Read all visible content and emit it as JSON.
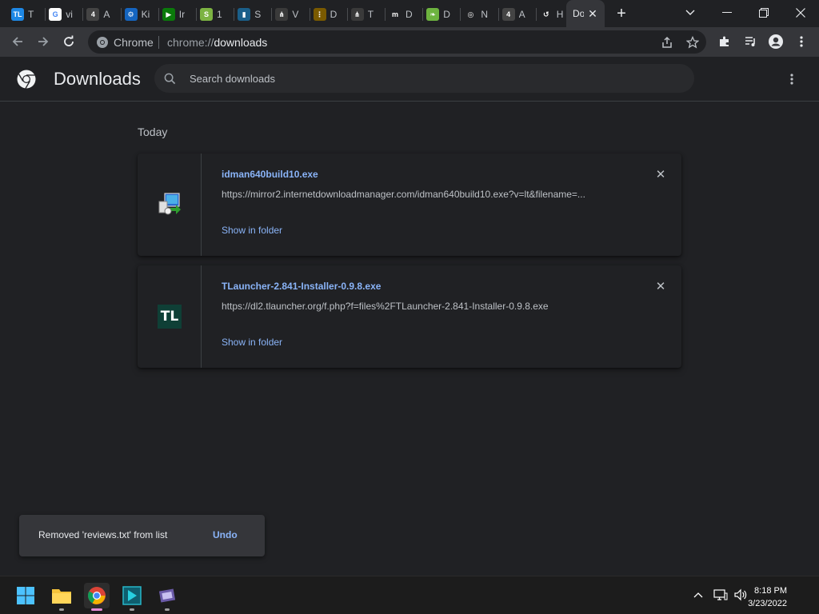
{
  "tabs": [
    {
      "fav": "TL",
      "title": "T",
      "bg": "#1e88e5"
    },
    {
      "fav": "G",
      "title": "vi",
      "bg": "#ffffff"
    },
    {
      "fav": "4",
      "title": "A",
      "bg": "#444444"
    },
    {
      "fav": "⚙",
      "title": "Ki",
      "bg": "#1565c0"
    },
    {
      "fav": "▶",
      "title": "Ir",
      "bg": "#0a7a0a"
    },
    {
      "fav": "S",
      "title": "1",
      "bg": "#7cb342"
    },
    {
      "fav": "▮",
      "title": "S",
      "bg": "#1a5f8a"
    },
    {
      "fav": "⋔",
      "title": "V",
      "bg": "#3a3a3a"
    },
    {
      "fav": "⋮",
      "title": "D",
      "bg": "#7a5a00"
    },
    {
      "fav": "⋔",
      "title": "T",
      "bg": "#3a3a3a"
    },
    {
      "fav": "m",
      "title": "D",
      "bg": "#202124"
    },
    {
      "fav": "❧",
      "title": "D",
      "bg": "#6db33f"
    },
    {
      "fav": "◎",
      "title": "N",
      "bg": "#202124"
    },
    {
      "fav": "4",
      "title": "A",
      "bg": "#444444"
    },
    {
      "fav": "↺",
      "title": "H",
      "bg": "#202124"
    }
  ],
  "active_tab": {
    "title": "Downloads"
  },
  "omnibox": {
    "site_label": "Chrome",
    "url_scheme": "chrome://",
    "url_host": "downloads"
  },
  "header": {
    "title": "Downloads",
    "search_placeholder": "Search downloads"
  },
  "list": {
    "date_label": "Today",
    "items": [
      {
        "name": "idman640build10.exe",
        "url": "https://mirror2.internetdownloadmanager.com/idman640build10.exe?v=lt&filename=...",
        "action": "Show in folder"
      },
      {
        "name": "TLauncher-2.841-Installer-0.9.8.exe",
        "url": "https://dl2.tlauncher.org/f.php?f=files%2FTLauncher-2.841-Installer-0.9.8.exe",
        "action": "Show in folder",
        "icon_text": "TL"
      }
    ]
  },
  "toast": {
    "message": "Removed 'reviews.txt' from list",
    "undo": "Undo"
  },
  "taskbar": {
    "time": "8:18 PM",
    "date": "3/23/2022"
  },
  "colors": {
    "accent": "#8ab4f8",
    "bg": "#202124",
    "toolbar": "#35363a"
  }
}
